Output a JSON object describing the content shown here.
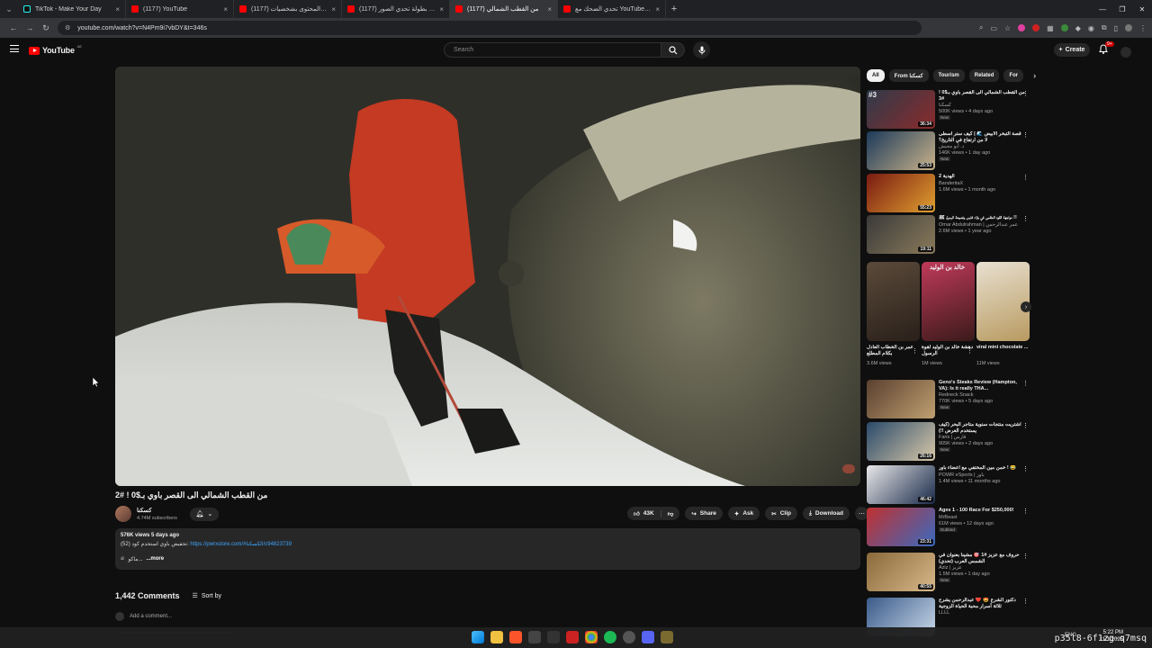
{
  "browser": {
    "tabs": [
      {
        "title": "TikTok - Make Your Day",
        "favicon_color": "#111111",
        "active": false
      },
      {
        "title": "(1177) YouTube",
        "favicon_color": "#ff0000",
        "active": false
      },
      {
        "title": "(1177) صناع المحتوى بشخصيات",
        "favicon_color": "#ff0000",
        "active": false
      },
      {
        "title": "(1177) بطولة تحدي الصور 🌙",
        "favicon_color": "#ff0000",
        "active": false
      },
      {
        "title": "(1177) من القطب الشمالي",
        "favicon_color": "#ff0000",
        "active": true
      },
      {
        "title": "تحدي الضحك مع YouTube - 😂 ‼️",
        "favicon_color": "#ff0000",
        "active": false
      }
    ],
    "url": "youtube.com/watch?v=N4Pm9i7vbDY&t=346s",
    "new_tab_label": "+",
    "close_label": "×"
  },
  "header": {
    "logo_text": "YouTube",
    "logo_country": "AE",
    "search_placeholder": "Search",
    "create_label": "Create",
    "notif_count": "9+"
  },
  "video": {
    "title": "من القطب الشمالي الى القصر باوي بـ$0 ! #2",
    "channel_name": "كسكنا",
    "subscribers": "4.74M subscribers",
    "likes": "43K",
    "share_label": "Share",
    "ask_label": "Ask",
    "clip_label": "Clip",
    "download_label": "Download",
    "views_date": "576K views  5 days ago",
    "desc_prefix": "تخفيض باوي استخدم كود (52): ",
    "desc_link": "https://pwrxstore.com/#الكسكنا/c94823739",
    "desc_tag": "ماكو...",
    "more_label": "...more"
  },
  "comments": {
    "count": "1,442 Comments",
    "sort_label": "Sort by",
    "add_placeholder": "Add a comment..."
  },
  "sidebar": {
    "chips": [
      "All",
      "From كسكنا",
      "Tourism",
      "Related",
      "For"
    ],
    "recs": [
      {
        "rank": "#3",
        "title": "من القطب الشمالي الى القصر باوي بـ$0 ! #3",
        "channel": "كسكنا",
        "views": "500K views • 4 days ago",
        "badge": "New",
        "duration": "36:34",
        "colors": [
          "#2f3a4a",
          "#8a2b2b"
        ]
      },
      {
        "rank": "",
        "title": "قصة التبخر الأبيض 🌊 | كيف ستر أسطى لا من ارتفاع في التاريخ؟",
        "channel": "د. أبو مجيش",
        "views": "146K views • 1 day ago",
        "badge": "New",
        "duration": "25:53",
        "colors": [
          "#1c3a5a",
          "#c9b28a"
        ]
      },
      {
        "rank": "",
        "title": "الهدية 2",
        "channel": "BanderitaX",
        "views": "1.6M views • 1 month ago",
        "badge": "",
        "duration": "55:23",
        "colors": [
          "#7a1a12",
          "#e0a030"
        ]
      },
      {
        "rank": "",
        "title": "مواجهة القوه العظمى في بلاد فارس ونصيحة الرسول ﷺ !!",
        "channel": "Omar Abdulrahman | عمر عبدالرحمن",
        "views": "2.6M views • 1 year ago",
        "badge": "",
        "duration": "19:11",
        "colors": [
          "#3a3a3a",
          "#8a7a5a"
        ]
      },
      {
        "rank": "",
        "title": "Geno's Steaks Review (Hampton, VA): Is it really THA...",
        "channel": "Redneck Snack",
        "views": "770K views • 5 days ago",
        "badge": "New",
        "duration": "",
        "colors": [
          "#5a4030",
          "#c0a070"
        ]
      },
      {
        "rank": "",
        "title": "اشتريت منتجات سنوية متاجر البحر (كيف يستخدم العرض !!)",
        "channel": "Faris | فارس",
        "views": "905K views • 2 days ago",
        "badge": "New",
        "duration": "26:16",
        "colors": [
          "#2a4a6a",
          "#d8c8a8"
        ]
      },
      {
        "rank": "",
        "title": "خمن مين المختفي مع اعضاء باور ! 😂",
        "channel": "POWR eSports | باور",
        "views": "1.4M views • 11 months ago",
        "badge": "",
        "duration": "46:42",
        "colors": [
          "#e8e8e8",
          "#1a2a4a"
        ]
      },
      {
        "rank": "",
        "title": "Ages 1 - 100 Race For $250,000!",
        "channel": "MrBeast",
        "views": "61M views • 12 days ago",
        "badge": "Dubbed",
        "duration": "23:31",
        "colors": [
          "#c03030",
          "#3a6ac0"
        ]
      },
      {
        "rank": "",
        "title": "حروف مع عزيز #1 🎯 مشينا بعنوان في الشمس العرب (تحدي)",
        "channel": "Aziz | عزيز",
        "views": "1.5M views • 1 day ago",
        "badge": "New",
        "duration": "40:55",
        "colors": [
          "#8a6a3a",
          "#d8b888"
        ]
      },
      {
        "rank": "",
        "title": "دكتور الشرع 🤩 ❤️ عبدالرحمن يشرح ثلاثة أسرار محبة الحياة الزوجية",
        "channel": "LLLL",
        "views": "",
        "badge": "",
        "duration": "",
        "colors": [
          "#3a5a8a",
          "#c8d8e8"
        ]
      }
    ],
    "shorts": [
      {
        "title": "عمر بن الخطاب العادل بكلام المطلع",
        "views": "3.6M views",
        "color": "#5a4a3a"
      },
      {
        "title": "دهشة خالد بن الوليد لقوة الرسول",
        "views": "1M views",
        "color": "#8a2a3a"
      },
      {
        "title": "viral mini chocolate ...",
        "views": "11M views",
        "color": "#c8b8a0"
      }
    ],
    "shorts_overlay": "خالد بن الوليد"
  },
  "taskbar": {
    "lang": "ENG",
    "time": "5:22 PM",
    "date": "11/1/2025",
    "watermark": "p35l8-6f1zg-q7msq"
  }
}
